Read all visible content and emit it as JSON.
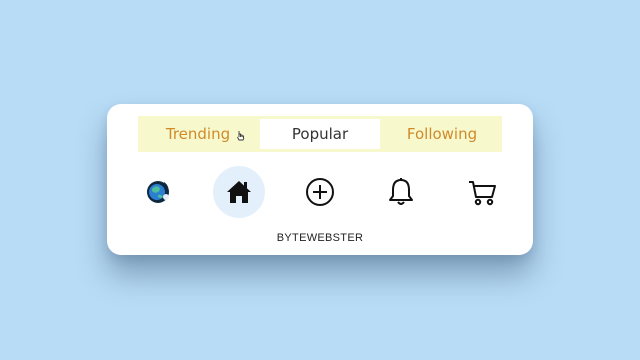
{
  "tabs": [
    {
      "label": "Trending",
      "active": false
    },
    {
      "label": "Popular",
      "active": true
    },
    {
      "label": "Following",
      "active": false
    }
  ],
  "nav": {
    "items": [
      {
        "icon": "planet-avatar-icon"
      },
      {
        "icon": "home-icon",
        "active": true
      },
      {
        "icon": "add-circle-icon"
      },
      {
        "icon": "bell-icon"
      },
      {
        "icon": "cart-icon"
      }
    ]
  },
  "brand": {
    "text": "BYTEWEBSTER"
  },
  "colors": {
    "background": "#b8dcf6",
    "tab_bar": "#f7f9cc",
    "tab_text": "#d08a2a",
    "active_nav": "#e3f0fb"
  }
}
